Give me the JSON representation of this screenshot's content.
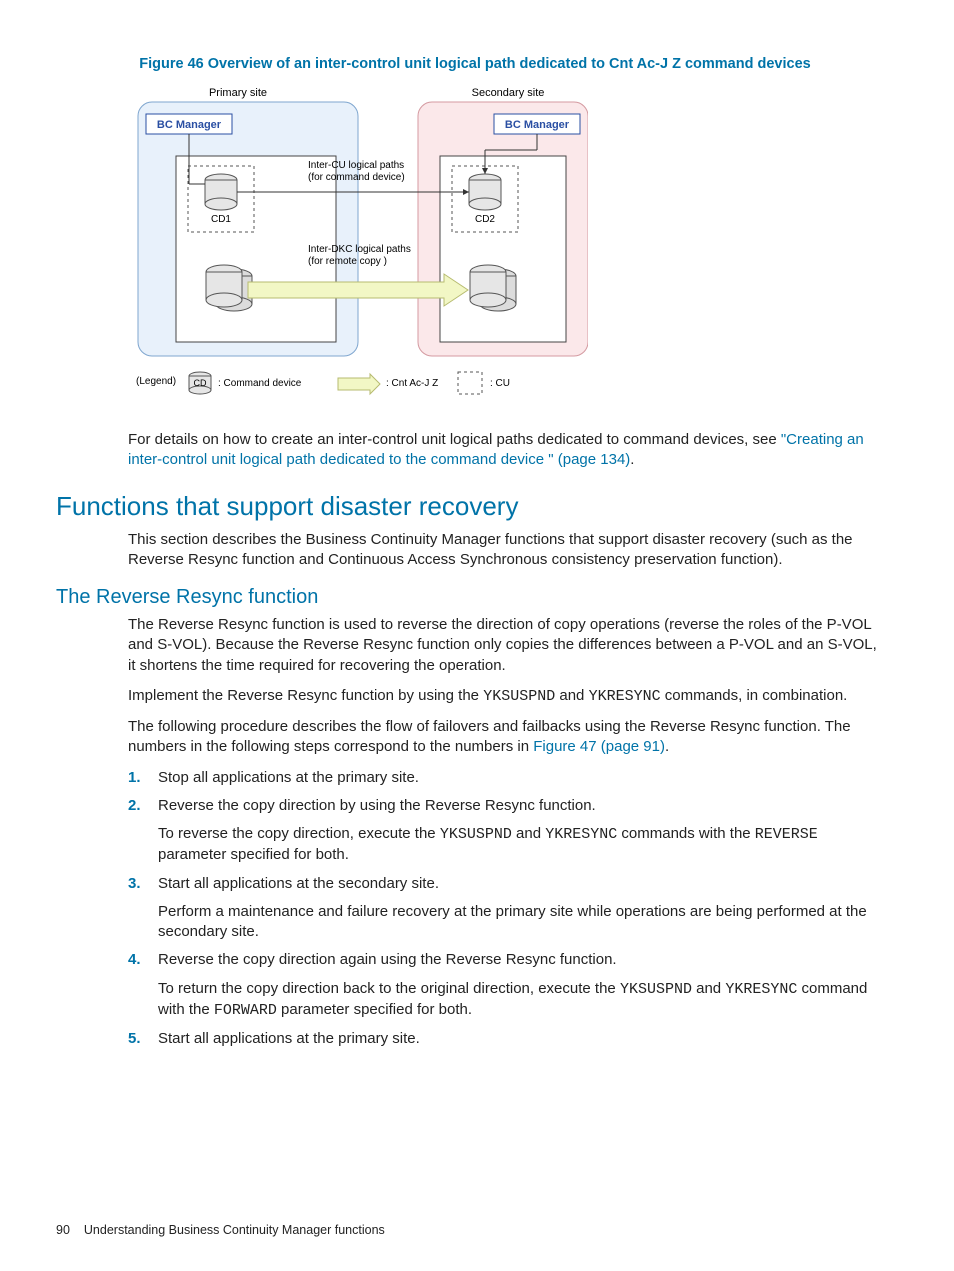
{
  "figure": {
    "caption": "Figure 46 Overview of an inter-control unit logical path dedicated to Cnt Ac-J Z command devices",
    "primary_site": "Primary site",
    "secondary_site": "Secondary site",
    "bc_manager": "BC Manager",
    "cd1": "CD1",
    "cd2": "CD2",
    "path_cu": "Inter-CU logical paths\n(for command device)",
    "path_dkc": "Inter-DKC logical paths\n(for remote copy )",
    "legend_label": "(Legend)",
    "legend_cd": "CD",
    "legend_cd_text": ": Command device",
    "legend_cnt": ": Cnt Ac-J Z",
    "legend_cu": ": CU"
  },
  "intro": {
    "p1": "For details on how to create an inter-control unit logical paths dedicated to command devices, see ",
    "link1": "\"Creating an inter-control unit logical path dedicated to the command device \" (page 134)",
    "p1_tail": "."
  },
  "h2": "Functions that support disaster recovery",
  "sec1_p": "This section describes the Business Continuity Manager functions that support disaster recovery (such as the Reverse Resync function and Continuous Access Synchronous consistency preservation function).",
  "h3": "The Reverse Resync function",
  "rr": {
    "p1": "The Reverse Resync function is used to reverse the direction of copy operations (reverse the roles of the P-VOL and S-VOL). Because the Reverse Resync function only copies the differences between a P-VOL and an S-VOL, it shortens the time required for recovering the operation.",
    "p2_a": "Implement the Reverse Resync function by using the ",
    "p2_code1": "YKSUSPND",
    "p2_b": " and ",
    "p2_code2": "YKRESYNC",
    "p2_c": " commands, in combination.",
    "p3_a": "The following procedure describes the flow of failovers and failbacks using the Reverse Resync function. The numbers in the following steps correspond to the numbers in ",
    "p3_link": "Figure 47 (page 91)",
    "p3_b": "."
  },
  "steps": [
    {
      "n": "1.",
      "lines": [
        "Stop all applications at the primary site."
      ]
    },
    {
      "n": "2.",
      "lines": [
        "Reverse the copy direction by using the Reverse Resync function.",
        {
          "frag": [
            "To reverse the copy direction, execute the ",
            {
              "code": "YKSUSPND"
            },
            " and ",
            {
              "code": "YKRESYNC"
            },
            " commands with the ",
            {
              "code": "REVERSE"
            },
            " parameter specified for both."
          ]
        }
      ]
    },
    {
      "n": "3.",
      "lines": [
        "Start all applications at the secondary site.",
        "Perform a maintenance and failure recovery at the primary site while operations are being performed at the secondary site."
      ]
    },
    {
      "n": "4.",
      "lines": [
        "Reverse the copy direction again using the Reverse Resync function.",
        {
          "frag": [
            "To return the copy direction back to the original direction, execute the ",
            {
              "code": "YKSUSPND"
            },
            " and ",
            {
              "code": "YKRESYNC"
            },
            " command with the ",
            {
              "code": "FORWARD"
            },
            " parameter specified for both."
          ]
        }
      ]
    },
    {
      "n": "5.",
      "lines": [
        "Start all applications at the primary site."
      ]
    }
  ],
  "footer": {
    "page": "90",
    "title": "Understanding Business Continuity Manager functions"
  }
}
